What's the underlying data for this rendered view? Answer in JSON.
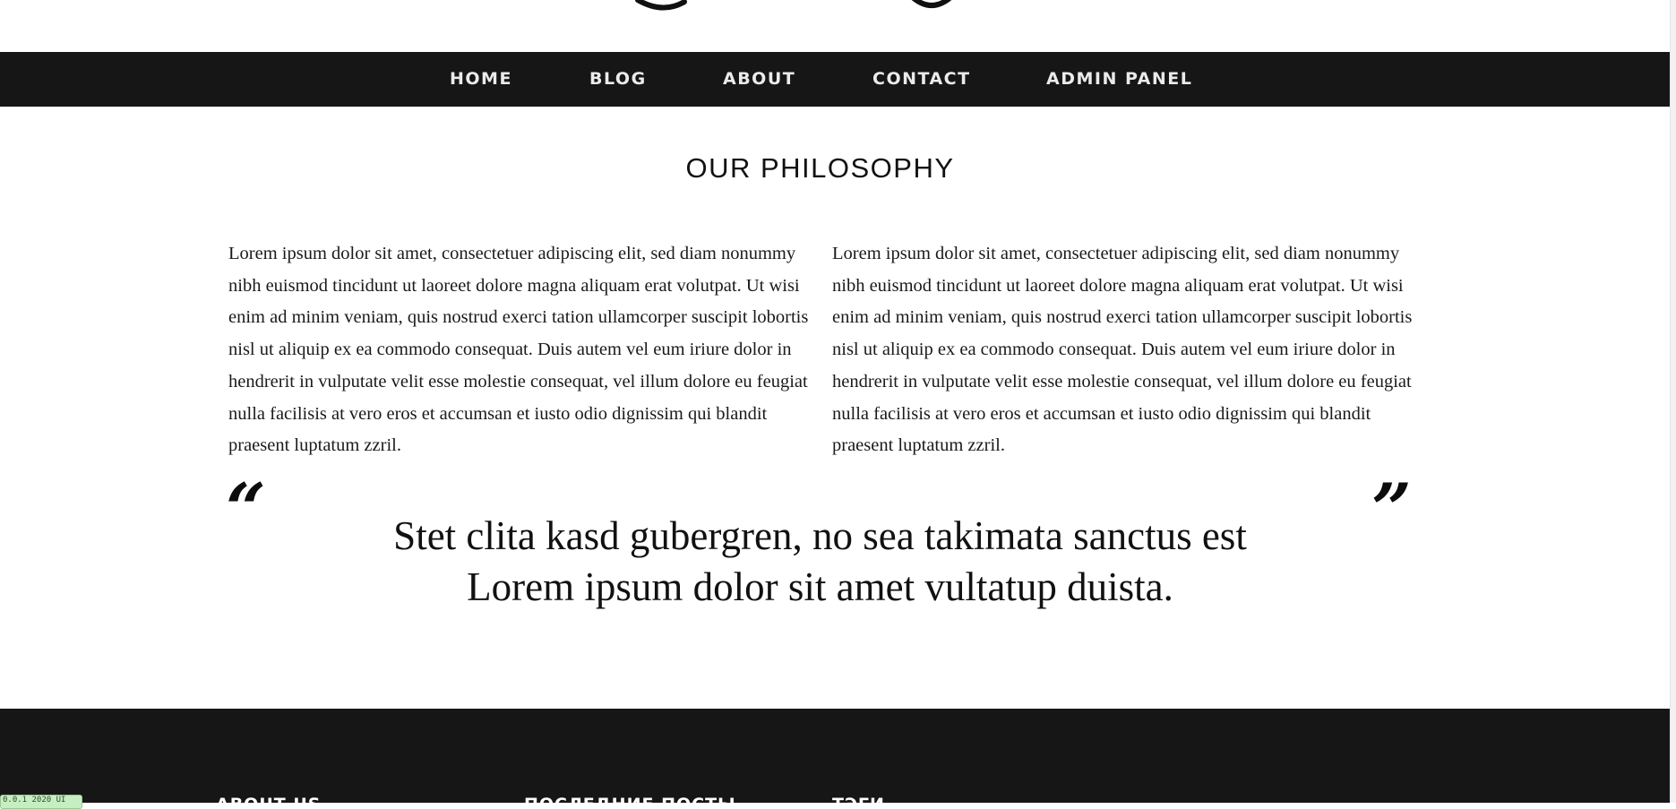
{
  "nav": {
    "items": [
      {
        "label": "HOME"
      },
      {
        "label": "BLOG"
      },
      {
        "label": "ABOUT"
      },
      {
        "label": "CONTACT"
      },
      {
        "label": "ADMIN PANEL"
      }
    ]
  },
  "philosophy": {
    "title": "OUR PHILOSOPHY",
    "paragraph_left": "Lorem ipsum dolor sit amet, consectetuer adipiscing elit, sed diam nonummy nibh euismod tincidunt ut laoreet dolore magna aliquam erat volutpat. Ut wisi enim ad minim veniam, quis nostrud exerci tation ullamcorper suscipit lobortis nisl ut aliquip ex ea commodo consequat. Duis autem vel eum iriure dolor in hendrerit in vulputate velit esse molestie consequat, vel illum dolore eu feugiat nulla facilisis at vero eros et accumsan et iusto odio dignissim qui blandit praesent luptatum zzril.",
    "paragraph_right": "Lorem ipsum dolor sit amet, consectetuer adipiscing elit, sed diam nonummy nibh euismod tincidunt ut laoreet dolore magna aliquam erat volutpat. Ut wisi enim ad minim veniam, quis nostrud exerci tation ullamcorper suscipit lobortis nisl ut aliquip ex ea commodo consequat. Duis autem vel eum iriure dolor in hendrerit in vulputate velit esse molestie consequat, vel illum dolore eu feugiat nulla facilisis at vero eros et accumsan et iusto odio dignissim qui blandit praesent luptatum zzril."
  },
  "quote": {
    "open_mark": "“",
    "close_mark": "”",
    "line1": "Stet clita kasd gubergren, no sea takimata sanctus est",
    "line2": "Lorem ipsum dolor sit amet vultatup duista."
  },
  "footer": {
    "headings": [
      {
        "label": "ABOUT US"
      },
      {
        "label": "ПОСЛЕДНИЕ ПОСТЫ"
      },
      {
        "label": "ТЭГИ"
      }
    ]
  },
  "debug_badge": {
    "text": "0.0.1 2020 UI"
  },
  "colors": {
    "navbar_bg": "#161616",
    "nav_text": "#ebebeb",
    "footer_bg": "#161616",
    "body_text": "#1a1a1a",
    "badge_bg": "#c6eec1"
  }
}
